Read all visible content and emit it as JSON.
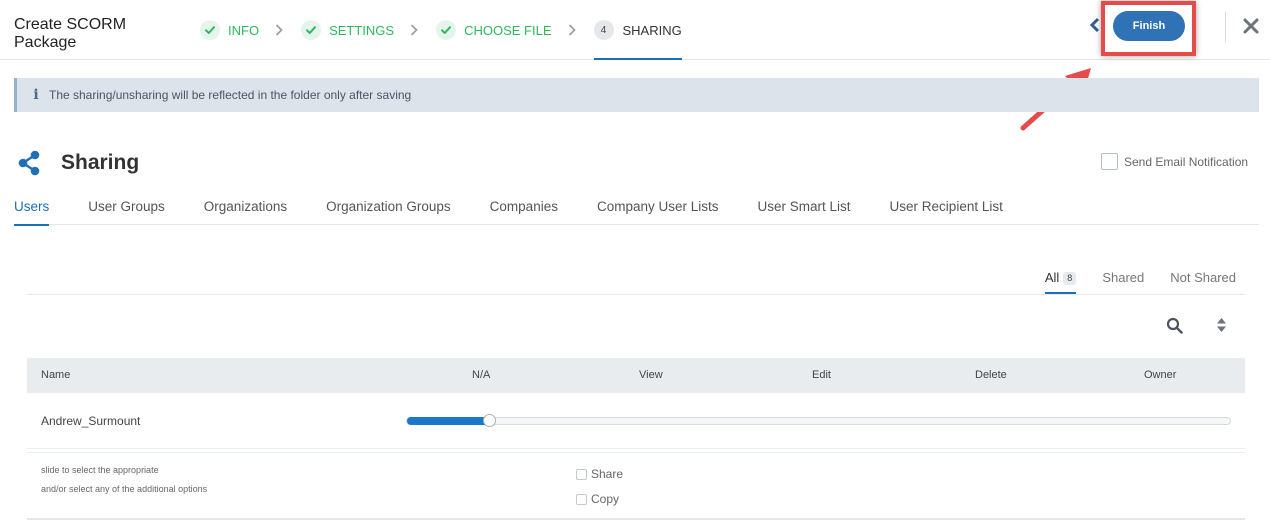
{
  "header": {
    "title": "Create SCORM Package",
    "steps": [
      {
        "label": "INFO",
        "status": "done"
      },
      {
        "label": "SETTINGS",
        "status": "done"
      },
      {
        "label": "CHOOSE FILE",
        "status": "done"
      },
      {
        "number": "4",
        "label": "SHARING",
        "status": "active"
      }
    ],
    "finish_label": "Finish"
  },
  "info_banner": {
    "icon": "info-icon",
    "text": "The sharing/unsharing will be reflected in the folder only after saving"
  },
  "section": {
    "icon": "share-icon",
    "title": "Sharing",
    "email_notification_label": "Send Email Notification"
  },
  "tabs": [
    {
      "label": "Users",
      "active": true
    },
    {
      "label": "User Groups"
    },
    {
      "label": "Organizations"
    },
    {
      "label": "Organization Groups"
    },
    {
      "label": "Companies"
    },
    {
      "label": "Company User Lists"
    },
    {
      "label": "User Smart List"
    },
    {
      "label": "User Recipient List"
    }
  ],
  "filters": {
    "all_label": "All",
    "all_count": "8",
    "shared_label": "Shared",
    "not_shared_label": "Not Shared"
  },
  "table": {
    "columns": [
      "Name",
      "N/A",
      "View",
      "Edit",
      "Delete",
      "Owner"
    ],
    "rows": [
      {
        "name": "Andrew_Surmount",
        "permission_level": 0.1
      }
    ],
    "hint_line1": "slide to select the appropriate",
    "hint_line2": "and/or select any of the additional options",
    "options": [
      "Share",
      "Copy"
    ]
  },
  "colors": {
    "accent": "#1e6fb4",
    "done_step": "#2eb85c",
    "finish_button": "#2f72b5",
    "annotation": "#e44b4b"
  }
}
